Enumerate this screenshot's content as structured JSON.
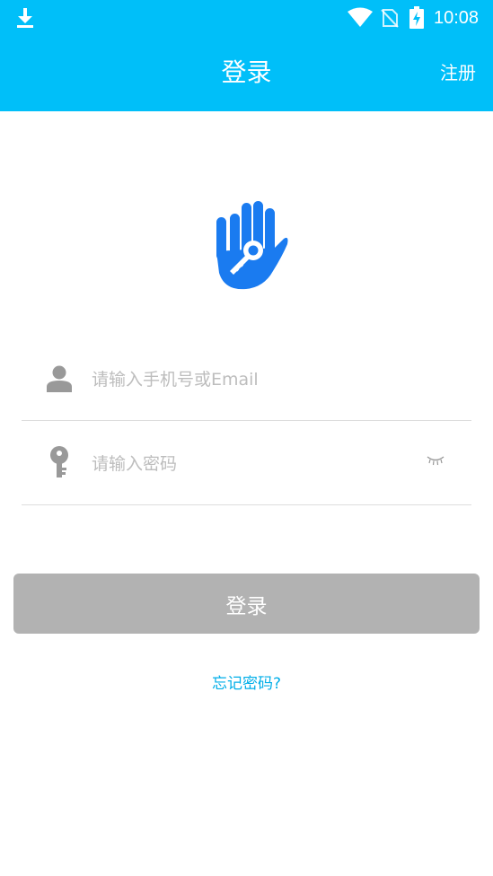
{
  "status_bar": {
    "time": "10:08",
    "icons": [
      "download-icon",
      "wifi-icon",
      "no-sim-icon",
      "battery-charging-icon"
    ]
  },
  "app_bar": {
    "title": "登录",
    "register_label": "注册"
  },
  "logo": {
    "icon": "hand-key-icon",
    "color": "#1a7bf0"
  },
  "form": {
    "account": {
      "icon": "user-icon",
      "placeholder": "请输入手机号或Email",
      "value": ""
    },
    "password": {
      "icon": "key-icon",
      "placeholder": "请输入密码",
      "value": "",
      "toggle_icon": "eye-closed-icon"
    }
  },
  "login_button": {
    "label": "登录",
    "state": "disabled"
  },
  "forgot_password": "忘记密码?",
  "colors": {
    "primary": "#00bff9",
    "button_disabled": "#b2b2b2",
    "link": "#00aee8",
    "logo": "#1a7bf0"
  }
}
